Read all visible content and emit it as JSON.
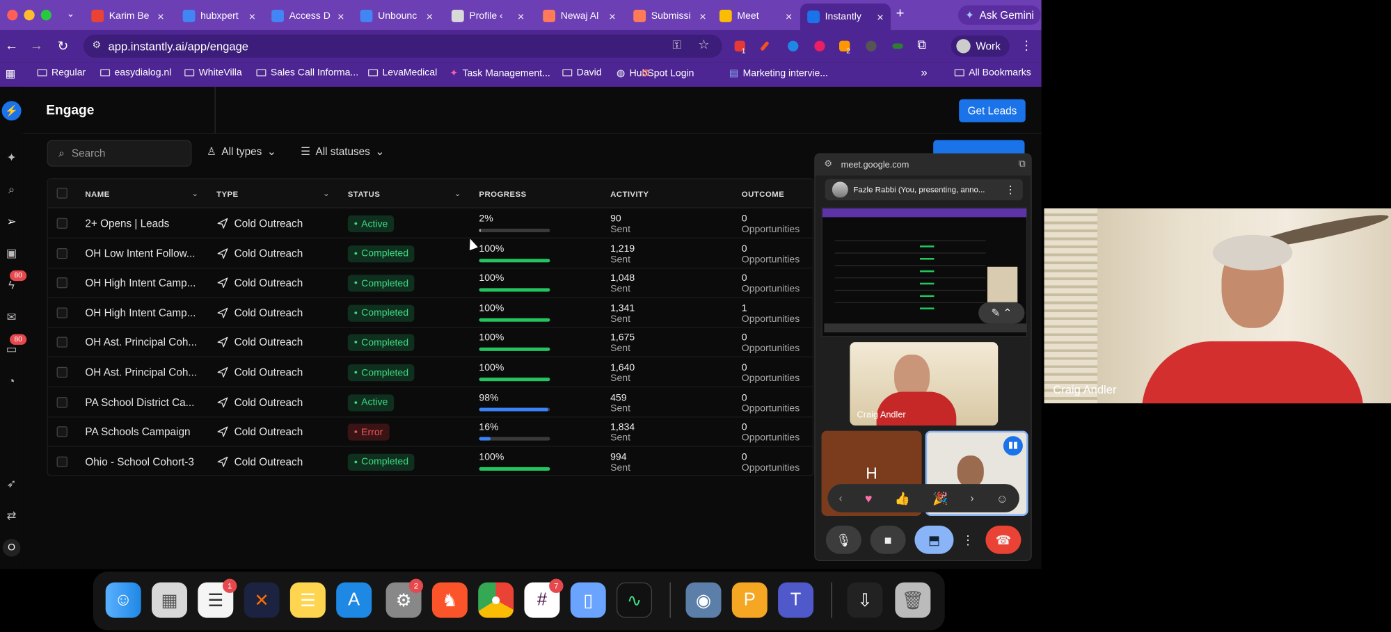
{
  "browser": {
    "tabs": [
      {
        "label": "Karim Be",
        "color": "#ea4335"
      },
      {
        "label": "hubxpert",
        "color": "#4285f4"
      },
      {
        "label": "Access D",
        "color": "#4285f4"
      },
      {
        "label": "Unbounc",
        "color": "#4285f4"
      },
      {
        "label": "Profile ‹",
        "color": "#d9d9d9"
      },
      {
        "label": "Newaj Al",
        "color": "#ff7a59"
      },
      {
        "label": "Submissi",
        "color": "#ff7a59"
      },
      {
        "label": "Meet",
        "color": "#fbbc04"
      },
      {
        "label": "Instantly",
        "color": "#1a73e8"
      }
    ],
    "ask_gemini": "Ask Gemini",
    "url": "app.instantly.ai/app/engage",
    "profile": "Work",
    "ext_badges": {
      "first": "1",
      "second": "2"
    },
    "bookmarks": [
      "Regular",
      "easydialog.nl",
      "WhiteVilla",
      "Sales Call Informa...",
      "LevaMedical",
      "Task Management...",
      "David",
      "HubSpot Login",
      "Marketing intervie..."
    ],
    "all_bookmarks": "All Bookmarks"
  },
  "app": {
    "title": "Engage",
    "get_leads": "Get Leads",
    "search_placeholder": "Search",
    "filter_types": "All types",
    "filter_statuses": "All statuses",
    "sidebar_badges": [
      "80",
      "80"
    ],
    "user_initial": "O",
    "columns": {
      "name": "NAME",
      "type": "TYPE",
      "status": "STATUS",
      "progress": "PROGRESS",
      "activity": "ACTIVITY",
      "outcome": "OUTCOME"
    },
    "rows": [
      {
        "name": "2+ Opens | Leads",
        "type": "Cold Outreach",
        "status": "Active",
        "status_kind": "active",
        "progress_label": "2%",
        "progress": 2,
        "bar_color": "#9e9e9e",
        "activity": "90",
        "activity_label": "Sent",
        "outcome": "0",
        "outcome_label": "Opportunities"
      },
      {
        "name": "OH Low Intent Follow...",
        "type": "Cold Outreach",
        "status": "Completed",
        "status_kind": "completed",
        "progress_label": "100%",
        "progress": 100,
        "bar_color": "#22c55e",
        "activity": "1,219",
        "activity_label": "Sent",
        "outcome": "0",
        "outcome_label": "Opportunities"
      },
      {
        "name": "OH High Intent Camp...",
        "type": "Cold Outreach",
        "status": "Completed",
        "status_kind": "completed",
        "progress_label": "100%",
        "progress": 100,
        "bar_color": "#22c55e",
        "activity": "1,048",
        "activity_label": "Sent",
        "outcome": "0",
        "outcome_label": "Opportunities"
      },
      {
        "name": "OH High Intent Camp...",
        "type": "Cold Outreach",
        "status": "Completed",
        "status_kind": "completed",
        "progress_label": "100%",
        "progress": 100,
        "bar_color": "#22c55e",
        "activity": "1,341",
        "activity_label": "Sent",
        "outcome": "1",
        "outcome_label": "Opportunities"
      },
      {
        "name": "OH Ast. Principal Coh...",
        "type": "Cold Outreach",
        "status": "Completed",
        "status_kind": "completed",
        "progress_label": "100%",
        "progress": 100,
        "bar_color": "#22c55e",
        "activity": "1,675",
        "activity_label": "Sent",
        "outcome": "0",
        "outcome_label": "Opportunities"
      },
      {
        "name": "OH Ast. Principal Coh...",
        "type": "Cold Outreach",
        "status": "Completed",
        "status_kind": "completed",
        "progress_label": "100%",
        "progress": 100,
        "bar_color": "#22c55e",
        "activity": "1,640",
        "activity_label": "Sent",
        "outcome": "0",
        "outcome_label": "Opportunities"
      },
      {
        "name": "PA School District Ca...",
        "type": "Cold Outreach",
        "status": "Active",
        "status_kind": "active",
        "progress_label": "98%",
        "progress": 98,
        "bar_color": "#3b82f6",
        "activity": "459",
        "activity_label": "Sent",
        "outcome": "0",
        "outcome_label": "Opportunities"
      },
      {
        "name": "PA Schools Campaign",
        "type": "Cold Outreach",
        "status": "Error",
        "status_kind": "error",
        "progress_label": "16%",
        "progress": 16,
        "bar_color": "#3b82f6",
        "activity": "1,834",
        "activity_label": "Sent",
        "outcome": "0",
        "outcome_label": "Opportunities"
      },
      {
        "name": "Ohio - School Cohort-3",
        "type": "Cold Outreach",
        "status": "Completed",
        "status_kind": "completed",
        "progress_label": "100%",
        "progress": 100,
        "bar_color": "#22c55e",
        "activity": "994",
        "activity_label": "Sent",
        "outcome": "0",
        "outcome_label": "Opportunities"
      }
    ]
  },
  "meet": {
    "url": "meet.google.com",
    "presenter": "Fazle Rabbi (You, presenting, anno...",
    "tile_craig_name": "Craig Andler",
    "tile_h_initial": "H",
    "main_name": "Craig Andler"
  },
  "dock": {
    "badges": [
      "1",
      "2",
      "7"
    ]
  }
}
